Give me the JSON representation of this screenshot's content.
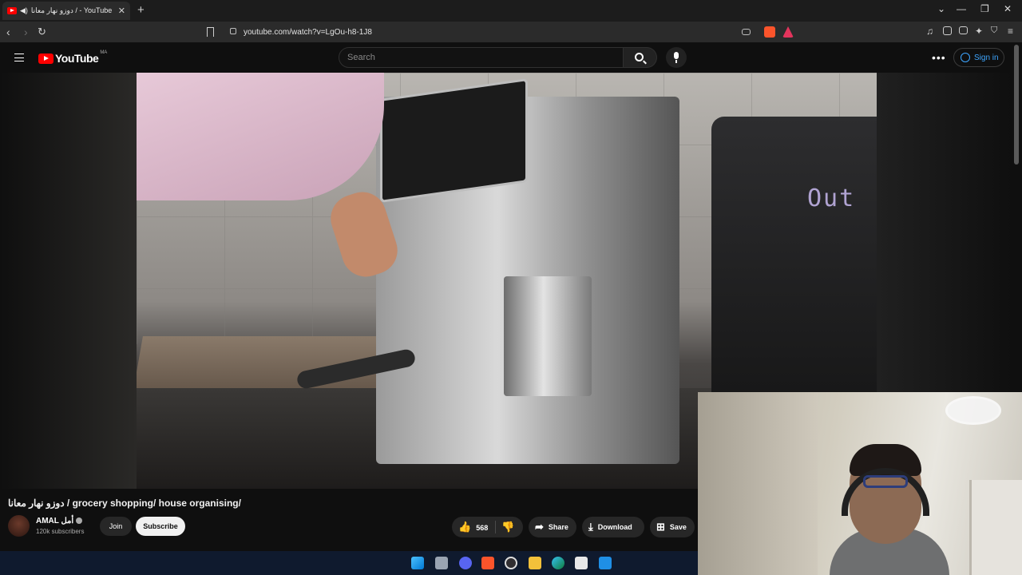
{
  "browser": {
    "tab_title": "دوزو نهار معانا / - YouTube",
    "tab_audio_icon": "speaker-icon",
    "close_tab": "✕",
    "new_tab": "+",
    "url": "youtube.com/watch?v=LgOu-h8-1J8",
    "window_controls": [
      "⌄",
      "—",
      "❐",
      "✕"
    ]
  },
  "youtube": {
    "logo_text": "YouTube",
    "country_code": "MA",
    "search_placeholder": "Search",
    "sign_in": "Sign in",
    "more": "•••"
  },
  "video": {
    "display_text": "Out",
    "title": "دوزو نهار معانا / grocery shopping/ house organising/",
    "channel_name": "AMAL أمل",
    "subscribers": "120k subscribers",
    "join_label": "Join",
    "subscribe_label": "Subscribe",
    "like_count": "568",
    "share_label": "Share",
    "download_label": "Download",
    "save_label": "Save"
  },
  "taskbar": {
    "icons": [
      "windows-start-icon",
      "task-view-icon",
      "discord-icon",
      "brave-icon",
      "obs-icon",
      "file-explorer-icon",
      "edge-icon",
      "store-icon",
      "mail-icon"
    ]
  },
  "colors": {
    "youtube_red": "#ff0000",
    "link_blue": "#3ea6ff",
    "background": "#0f0f0f"
  }
}
